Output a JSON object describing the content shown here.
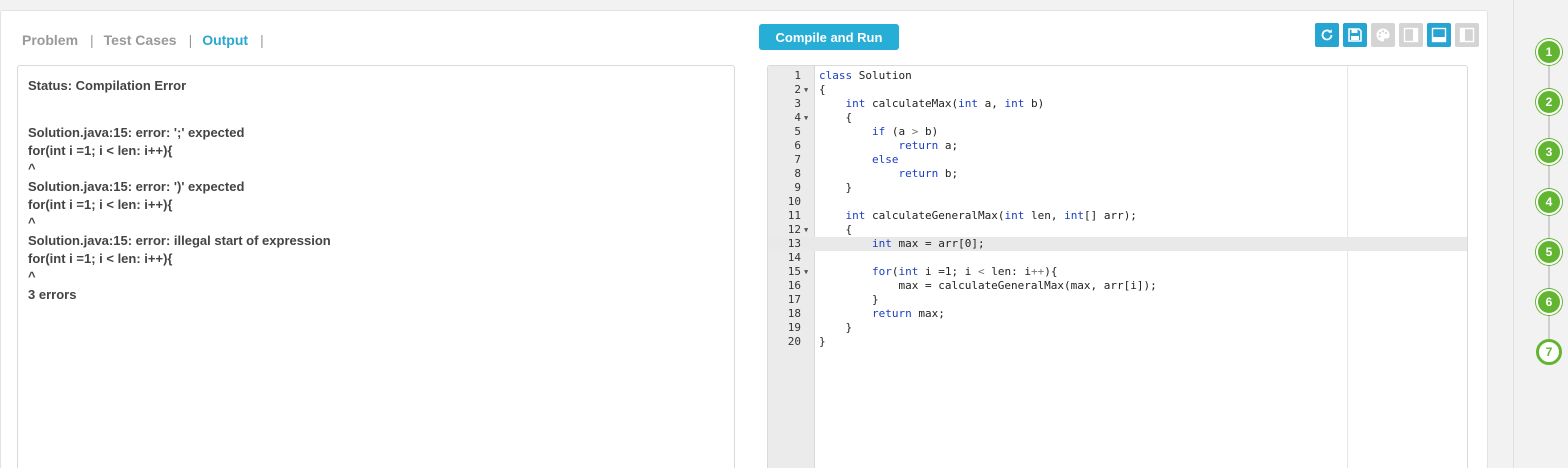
{
  "tabs": [
    {
      "label": "Problem",
      "active": false
    },
    {
      "label": "Test Cases",
      "active": false
    },
    {
      "label": "Output",
      "active": true
    }
  ],
  "output": {
    "status": "Status: Compilation Error",
    "lines": [
      "Solution.java:15: error: ';' expected",
      "for(int i =1; i < len: i++){",
      "^",
      "Solution.java:15: error: ')' expected",
      "for(int i =1; i < len: i++){",
      "^",
      "Solution.java:15: error: illegal start of expression",
      "for(int i =1; i < len: i++){",
      "^",
      "3 errors"
    ]
  },
  "run_button": {
    "label": "Compile and Run"
  },
  "toolbar": [
    {
      "name": "reset-icon",
      "active": true
    },
    {
      "name": "save-icon",
      "active": true
    },
    {
      "name": "theme-palette-icon",
      "active": false
    },
    {
      "name": "layout-side-panel-icon",
      "active": false
    },
    {
      "name": "layout-bottom-panel-icon",
      "active": true
    },
    {
      "name": "layout-left-panel-icon",
      "active": false
    }
  ],
  "editor": {
    "active_line": 13,
    "lines": [
      {
        "n": "1",
        "fold": false,
        "code": "class Solution"
      },
      {
        "n": "2",
        "fold": true,
        "code": "{"
      },
      {
        "n": "3",
        "fold": false,
        "code": "    int calculateMax(int a, int b)"
      },
      {
        "n": "4",
        "fold": true,
        "code": "    {"
      },
      {
        "n": "5",
        "fold": false,
        "code": "        if (a > b)"
      },
      {
        "n": "6",
        "fold": false,
        "code": "            return a;"
      },
      {
        "n": "7",
        "fold": false,
        "code": "        else"
      },
      {
        "n": "8",
        "fold": false,
        "code": "            return b;"
      },
      {
        "n": "9",
        "fold": false,
        "code": "    }"
      },
      {
        "n": "10",
        "fold": false,
        "code": ""
      },
      {
        "n": "11",
        "fold": false,
        "code": "    int calculateGeneralMax(int len, int[] arr);"
      },
      {
        "n": "12",
        "fold": true,
        "code": "    {"
      },
      {
        "n": "13",
        "fold": false,
        "code": "        int max = arr[0];"
      },
      {
        "n": "14",
        "fold": false,
        "code": ""
      },
      {
        "n": "15",
        "fold": true,
        "code": "        for(int i =1; i < len: i++){"
      },
      {
        "n": "16",
        "fold": false,
        "code": "            max = calculateGeneralMax(max, arr[i]);"
      },
      {
        "n": "17",
        "fold": false,
        "code": "        }"
      },
      {
        "n": "18",
        "fold": false,
        "code": "        return max;"
      },
      {
        "n": "19",
        "fold": false,
        "code": "    }"
      },
      {
        "n": "20",
        "fold": false,
        "code": "}"
      }
    ]
  },
  "steps": [
    {
      "label": "1",
      "current": false
    },
    {
      "label": "2",
      "current": false
    },
    {
      "label": "3",
      "current": false
    },
    {
      "label": "4",
      "current": false
    },
    {
      "label": "5",
      "current": false
    },
    {
      "label": "6",
      "current": false
    },
    {
      "label": "7",
      "current": true
    }
  ],
  "colors": {
    "accent": "#27aed7",
    "step_green": "#62b531",
    "keyword": "#1b3fbf"
  }
}
